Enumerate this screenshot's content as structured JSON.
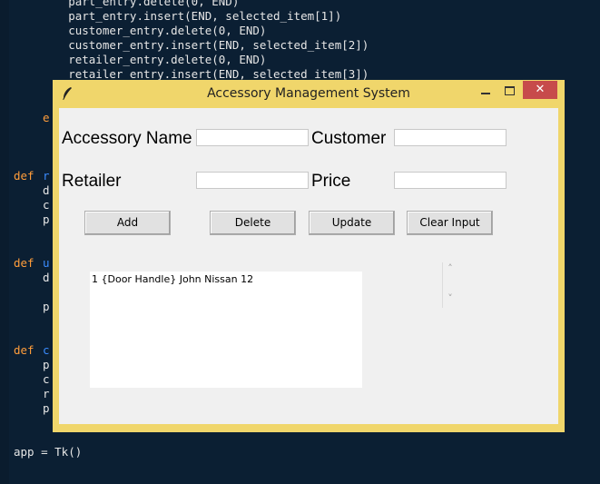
{
  "editor": {
    "lines": [
      "        part_entry.delete(0, END)",
      "        part_entry.insert(END, selected_item[1])",
      "        customer_entry.delete(0, END)",
      "        customer_entry.insert(END, selected_item[2])",
      "        retailer_entry.delete(0, END)",
      "        retailer_entry.insert(END, selected_item[3])"
    ],
    "partials": {
      "e": "e",
      "def1": "def",
      "r1": "r",
      "d1": "d",
      "c1": "c",
      "p1": "p",
      "def2": "def",
      "u2": "u",
      "d2": "d",
      "p2": "p",
      "def3": "def",
      "c3": "c",
      "p3": "p",
      "c3b": "c",
      "r3": "r",
      "p3b": "p"
    },
    "app_line": "app = Tk()"
  },
  "window": {
    "title": "Accessory Management System",
    "close_glyph": "✕"
  },
  "form": {
    "accessory_name_label": "Accessory Name",
    "customer_label": "Customer",
    "retailer_label": "Retailer",
    "price_label": "Price",
    "accessory_name_value": "",
    "customer_value": "",
    "retailer_value": "",
    "price_value": ""
  },
  "buttons": {
    "add": "Add",
    "delete": "Delete",
    "update": "Update",
    "clear": "Clear Input"
  },
  "listbox": {
    "items": [
      "1 {Door Handle} John Nissan 12"
    ]
  },
  "scrollbar": {
    "up": "˄",
    "down": "˅"
  }
}
